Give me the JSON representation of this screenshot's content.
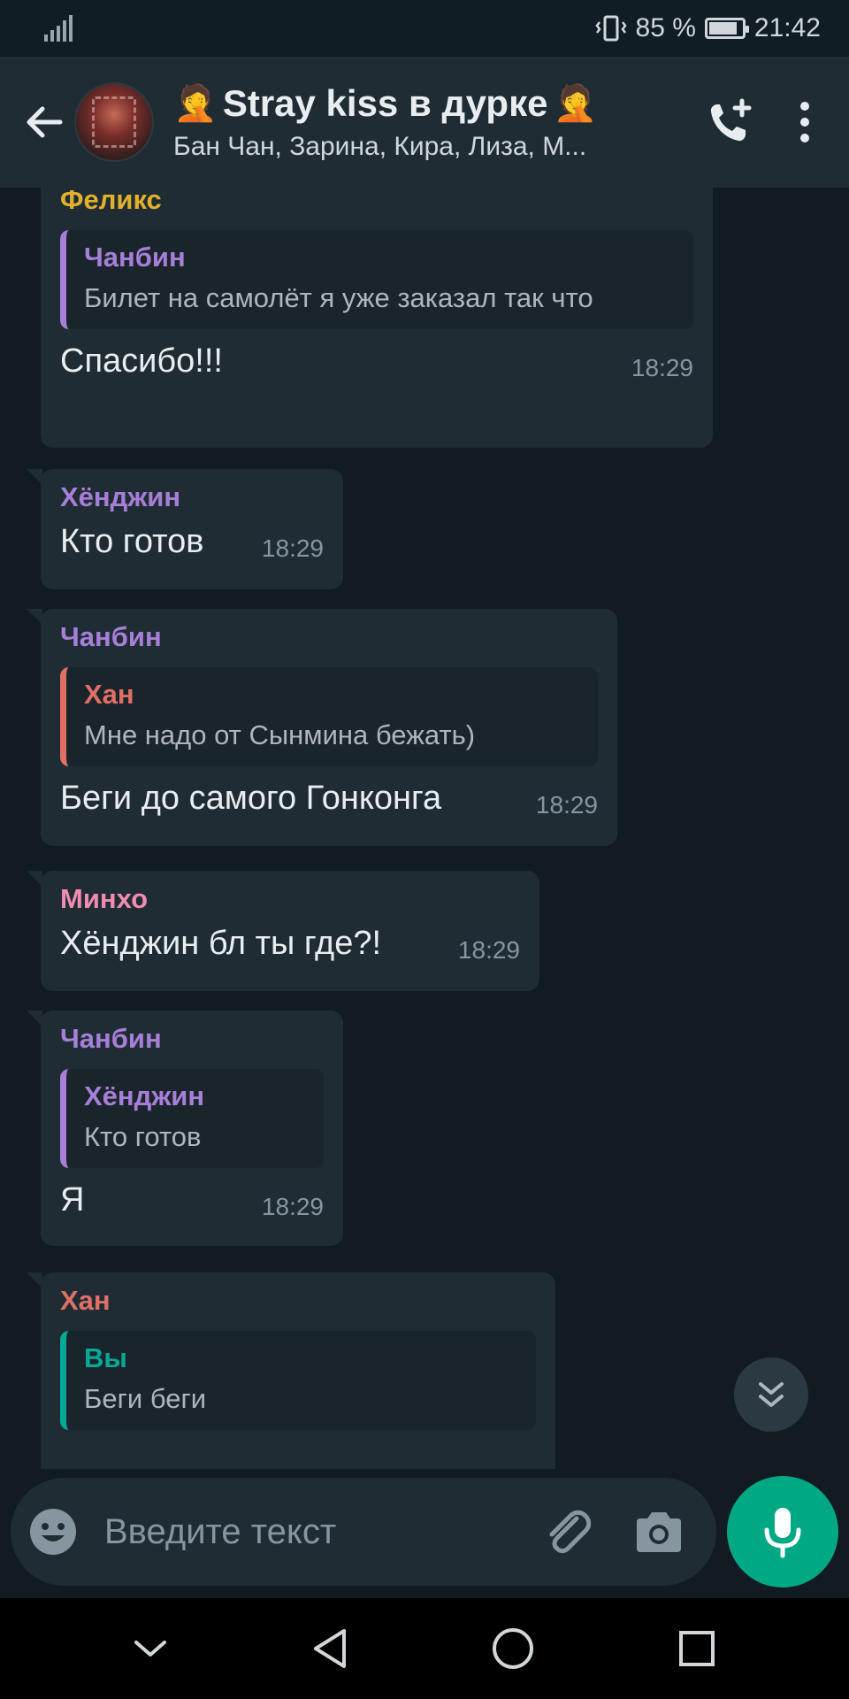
{
  "status_bar": {
    "battery": "85 %",
    "time": "21:42"
  },
  "header": {
    "title": "Stray kiss в дурке",
    "emoji_left": "🤦",
    "emoji_right": "🤦",
    "subtitle": "Бан Чан, Зарина, Кира, Лиза, М..."
  },
  "messages": [
    {
      "sender": "Феликс",
      "sender_color": "#e1b12c",
      "quote": {
        "name": "Чанбин",
        "name_color": "#a77fd9",
        "bar_color": "#a77fd9",
        "text": "Билет на самолёт я уже заказал так что"
      },
      "text": "Спасибо!!!",
      "time": "18:29"
    },
    {
      "sender": "Хёнджин",
      "sender_color": "#a77fd9",
      "text": "Кто готов",
      "time": "18:29"
    },
    {
      "sender": "Чанбин",
      "sender_color": "#a77fd9",
      "quote": {
        "name": "Хан",
        "name_color": "#e07066",
        "bar_color": "#e07066",
        "text": "Мне надо от Сынмина бежать)"
      },
      "text": "Беги до самого Гонконга",
      "time": "18:29"
    },
    {
      "sender": "Минхо",
      "sender_color": "#f28cb1",
      "text": "Хёнджин бл ты где?!",
      "time": "18:29"
    },
    {
      "sender": "Чанбин",
      "sender_color": "#a77fd9",
      "quote": {
        "name": "Хёнджин",
        "name_color": "#a77fd9",
        "bar_color": "#a77fd9",
        "text": "Кто готов"
      },
      "text": "Я",
      "time": "18:29"
    },
    {
      "sender": "Хан",
      "sender_color": "#e07066",
      "quote": {
        "name": "Вы",
        "name_color": "#06a996",
        "bar_color": "#06a996",
        "text": "Беги беги"
      },
      "text": "",
      "time": ""
    }
  ],
  "input": {
    "placeholder": "Введите текст"
  },
  "icons": {
    "back": "arrow-left-icon",
    "call": "add-call-icon",
    "menu": "more-vert-icon",
    "emoji": "emoji-icon",
    "attach": "paperclip-icon",
    "camera": "camera-icon",
    "mic": "mic-icon",
    "scroll": "double-chevron-down-icon"
  },
  "colors": {
    "accent": "#00a884",
    "bubble": "#1f2c34",
    "background": "#121b22"
  }
}
